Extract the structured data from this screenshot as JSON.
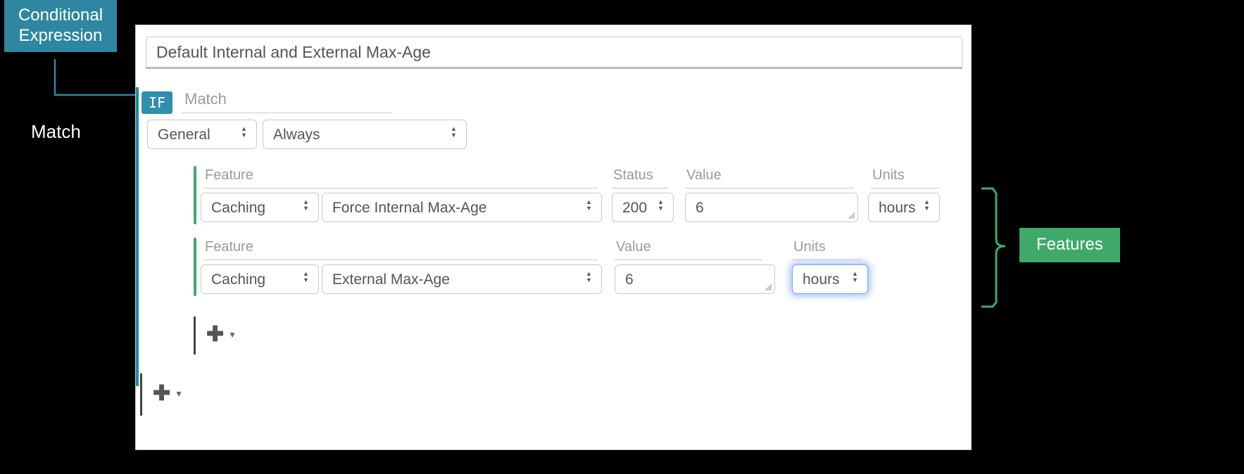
{
  "annotations": {
    "conditional_label_l1": "Conditional",
    "conditional_label_l2": "Expression",
    "match_label": "Match",
    "features_label": "Features"
  },
  "title": "Default Internal and External Max-Age",
  "if_badge": "IF",
  "match_header": "Match",
  "match_row": {
    "category": "General",
    "condition": "Always"
  },
  "columns": {
    "feature": "Feature",
    "status": "Status",
    "value": "Value",
    "units": "Units"
  },
  "feature_rows": [
    {
      "category": "Caching",
      "name": "Force Internal Max-Age",
      "status": "200",
      "value": "6",
      "units": "hours"
    },
    {
      "category": "Caching",
      "name": "External Max-Age",
      "value": "6",
      "units": "hours"
    }
  ]
}
